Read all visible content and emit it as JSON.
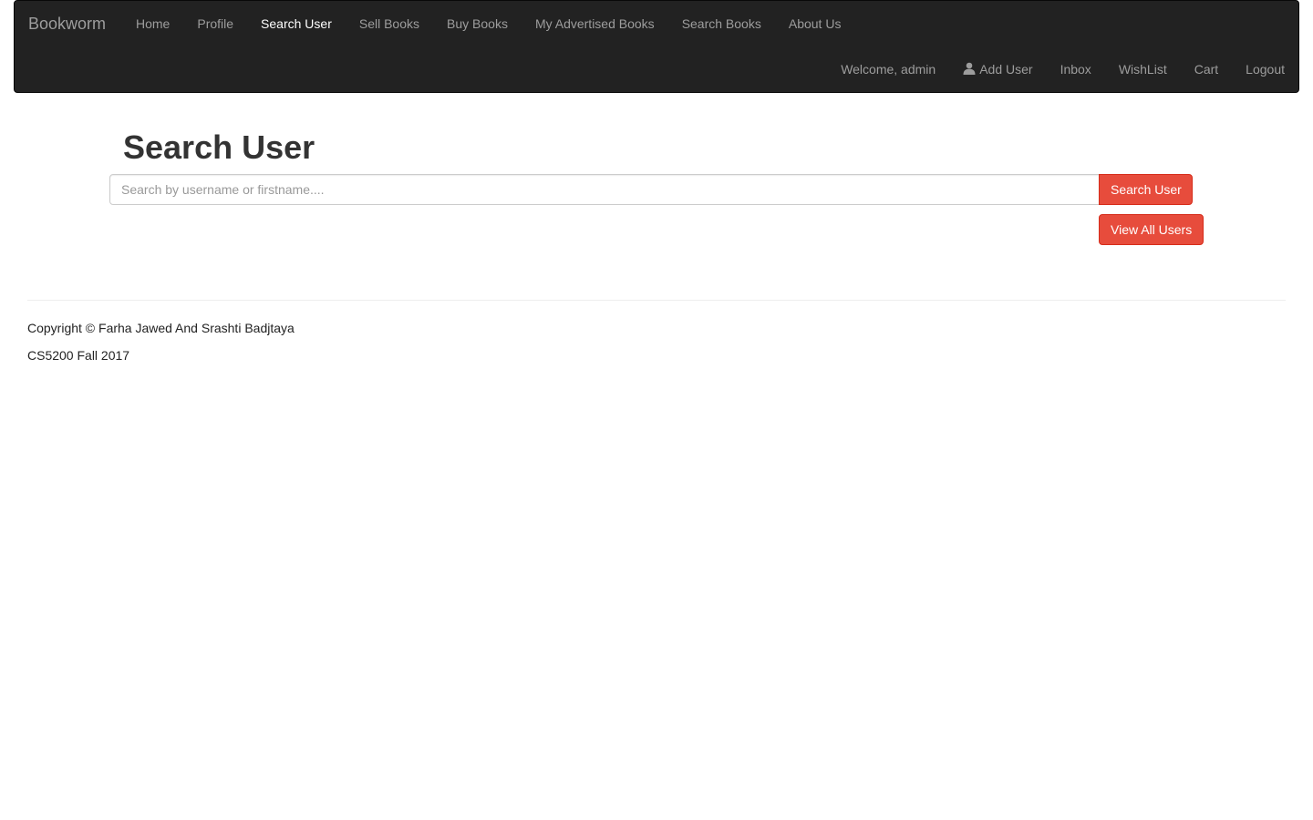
{
  "navbar": {
    "brand": "Bookworm",
    "left_links": [
      {
        "label": "Home"
      },
      {
        "label": "Profile"
      },
      {
        "label": "Search User",
        "active": true
      },
      {
        "label": "Sell Books"
      },
      {
        "label": "Buy Books"
      },
      {
        "label": "My Advertised Books"
      },
      {
        "label": "Search Books"
      },
      {
        "label": "About Us"
      }
    ],
    "welcome": "Welcome, admin",
    "add_user_icon": "user-icon",
    "add_user": "Add User",
    "inbox": "Inbox",
    "wishlist": "WishList",
    "cart": "Cart",
    "logout": "Logout"
  },
  "main": {
    "title": "Search User",
    "search_placeholder": "Search by username or firstname....",
    "search_value": "",
    "search_button": "Search User",
    "view_all_button": "View All Users"
  },
  "footer": {
    "copyright": "Copyright © Farha Jawed And Srashti Badjtaya",
    "course": "CS5200 Fall 2017"
  },
  "colors": {
    "navbar_bg": "#222222",
    "nav_text": "#9d9d9d",
    "nav_active": "#ffffff",
    "button_red": "#e74c3c"
  }
}
